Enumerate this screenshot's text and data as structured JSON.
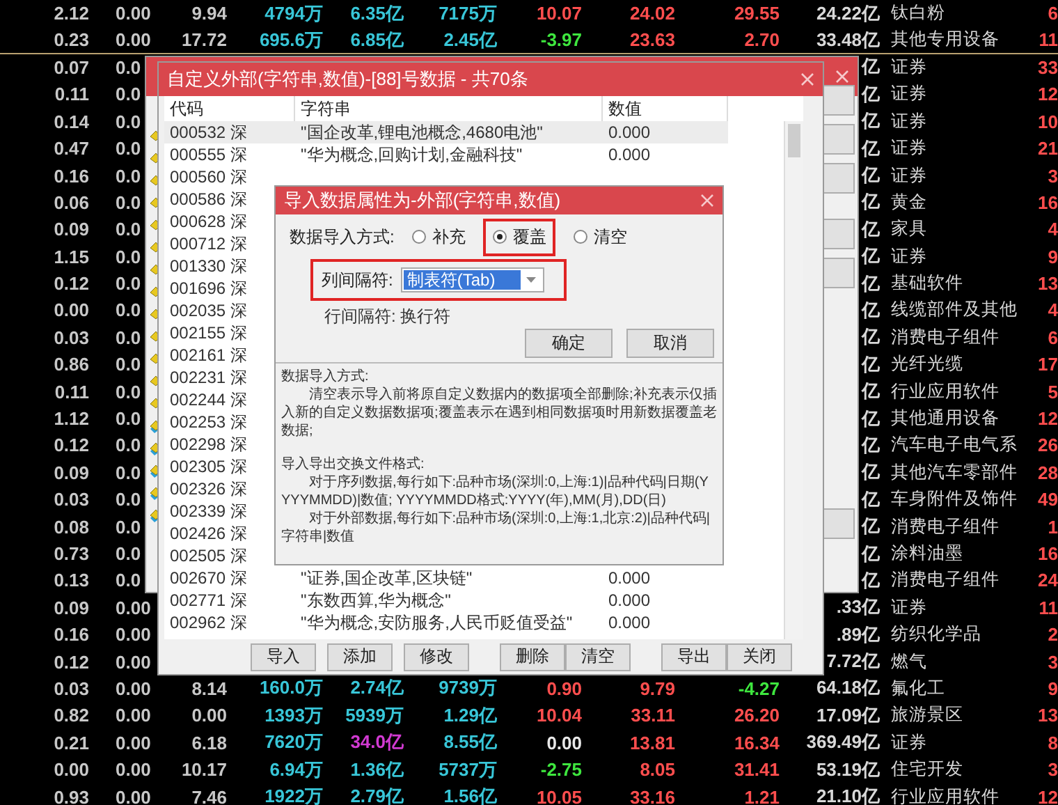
{
  "quote_table": {
    "rows": [
      {
        "cells": {
          "c1": "2.12",
          "c2": "0.00",
          "c3": "9.94",
          "c4": "4794万",
          "c5": "6.35亿",
          "c6": "7175万",
          "c7": "10.07",
          "c8": "24.02",
          "c9": "29.55",
          "c10": "24.22亿",
          "c11": "钛白粉",
          "c12": "6"
        }
      },
      {
        "cells": {
          "c1": "0.23",
          "c2": "0.00",
          "c3": "17.72",
          "c4": "695.6万",
          "c5": "6.85亿",
          "c6": "2.45亿",
          "c7": {
            "text": "-3.97",
            "color": "#3ee63e"
          },
          "c8": "23.63",
          "c9": "2.70",
          "c10": "33.48亿",
          "c11": "其他专用设备",
          "c12": "11"
        },
        "group_break": true
      },
      {
        "cells": {
          "c1": "0.07",
          "c2": "0.0",
          "c10": "亿",
          "c11": "证券",
          "c12": "33"
        }
      },
      {
        "cells": {
          "c1": "0.11",
          "c2": "0.0",
          "c10": "亿",
          "c11": "证券",
          "c12": "12"
        }
      },
      {
        "cells": {
          "c1": "0.14",
          "c2": "0.0",
          "c10": "亿",
          "c11": "证券",
          "c12": "10"
        }
      },
      {
        "cells": {
          "c1": "0.47",
          "c2": "0.0",
          "c10": "亿",
          "c11": "证券",
          "c12": "21"
        }
      },
      {
        "cells": {
          "c1": "0.16",
          "c2": "0.0",
          "c10": "亿",
          "c11": "证券",
          "c12": "3"
        }
      },
      {
        "cells": {
          "c1": "0.06",
          "c2": "0.0",
          "c10": "亿",
          "c11": "黄金",
          "c12": "16"
        }
      },
      {
        "cells": {
          "c1": "0.09",
          "c2": "0.0",
          "c10": "亿",
          "c11": "家具",
          "c12": "4"
        }
      },
      {
        "cells": {
          "c1": "1.15",
          "c2": "0.0",
          "c10": "亿",
          "c11": "证券",
          "c12": "9"
        }
      },
      {
        "cells": {
          "c1": "0.12",
          "c2": "0.0",
          "c10": "亿",
          "c11": "基础软件",
          "c12": "13"
        }
      },
      {
        "cells": {
          "c1": "0.00",
          "c2": "0.0",
          "c10": "亿",
          "c11": "线缆部件及其他",
          "c12": "4"
        }
      },
      {
        "cells": {
          "c1": "0.03",
          "c2": "0.0",
          "c10": "亿",
          "c11": "消费电子组件",
          "c12": "6"
        }
      },
      {
        "cells": {
          "c1": "0.86",
          "c2": "0.0",
          "c10": "亿",
          "c11": "光纤光缆",
          "c12": "17"
        }
      },
      {
        "cells": {
          "c1": "0.11",
          "c2": "0.0",
          "c10": "亿",
          "c11": "行业应用软件",
          "c12": "5"
        }
      },
      {
        "cells": {
          "c1": "1.12",
          "c2": "0.0",
          "c10": "亿",
          "c11": "其他通用设备",
          "c12": "12"
        }
      },
      {
        "cells": {
          "c1": "0.12",
          "c2": "0.0",
          "c10": "亿",
          "c11": "汽车电子电气系",
          "c12": "26"
        }
      },
      {
        "cells": {
          "c1": "0.09",
          "c2": "0.0",
          "c10": "亿",
          "c11": "其他汽车零部件",
          "c12": "28"
        }
      },
      {
        "cells": {
          "c1": "0.03",
          "c2": "0.0",
          "c10": "亿",
          "c11": "车身附件及饰件",
          "c12": "49"
        }
      },
      {
        "cells": {
          "c1": "0.08",
          "c2": "0.0",
          "c10": "亿",
          "c11": "消费电子组件",
          "c12": "1"
        }
      },
      {
        "cells": {
          "c1": "0.73",
          "c2": "0.0",
          "c10": "亿",
          "c11": "涂料油墨",
          "c12": "16"
        }
      },
      {
        "cells": {
          "c1": "0.13",
          "c2": "0.0",
          "c10": "亿",
          "c11": "消费电子组件",
          "c12": "24"
        }
      },
      {
        "cells": {
          "c1": "0.09",
          "c2": "0.00",
          "c10": ".33亿",
          "c11": "证券",
          "c12": "11"
        }
      },
      {
        "cells": {
          "c1": "0.16",
          "c2": "0.00",
          "c10": ".89亿",
          "c11": "纺织化学品",
          "c12": "2"
        }
      },
      {
        "cells": {
          "c1": "0.12",
          "c2": "0.00",
          "c10": "7.72亿",
          "c11": "燃气",
          "c12": "3"
        }
      },
      {
        "cells": {
          "c1": "0.03",
          "c2": "0.00",
          "c3": "8.14",
          "c4": "160.0万",
          "c5": "2.74亿",
          "c6": "9739万",
          "c7": "0.90",
          "c8": "9.79",
          "c9": {
            "text": "-4.27",
            "color": "#3ee63e"
          },
          "c10": "64.18亿",
          "c11": "氟化工",
          "c12": "9"
        }
      },
      {
        "cells": {
          "c1": "0.82",
          "c2": "0.00",
          "c3": "0.00",
          "c4": "1393万",
          "c5": "5939万",
          "c6": "1.29亿",
          "c7": "10.04",
          "c8": "33.11",
          "c9": "26.20",
          "c10": "17.09亿",
          "c11": "旅游景区",
          "c12": "13"
        }
      },
      {
        "cells": {
          "c1": "0.21",
          "c2": "0.00",
          "c3": "6.18",
          "c4": "7620万",
          "c5": {
            "text": "34.0亿",
            "color": "#d23ad2"
          },
          "c6": "8.55亿",
          "c7": {
            "text": "0.00",
            "color": "#e8e8e8"
          },
          "c8": "13.81",
          "c9": "16.34",
          "c10": "369.49亿",
          "c11": "证券",
          "c12": "8"
        }
      },
      {
        "cells": {
          "c1": "0.00",
          "c2": "0.00",
          "c3": "10.17",
          "c4": "6.94万",
          "c5": "1.36亿",
          "c6": "5737万",
          "c7": {
            "text": "-2.75",
            "color": "#3ee63e"
          },
          "c8": "8.05",
          "c9": "31.41",
          "c10": "53.19亿",
          "c11": "住宅开发",
          "c12": "3"
        }
      },
      {
        "cells": {
          "c1": "0.93",
          "c2": "0.00",
          "c3": "7.46",
          "c4": "1922万",
          "c5": "2.79亿",
          "c6": "1.56亿",
          "c7": "10.05",
          "c8": "33.16",
          "c9": "1.21",
          "c10": "21.10亿",
          "c11": "行业应用软件",
          "c12": "12"
        }
      }
    ]
  },
  "back_window": {
    "item_icons": [
      {
        "kind": "plain"
      },
      {
        "kind": "plain"
      },
      {
        "kind": "plain"
      },
      {
        "kind": "plain"
      },
      {
        "kind": "plain"
      },
      {
        "kind": "plain"
      },
      {
        "kind": "plain"
      },
      {
        "kind": "plain"
      },
      {
        "kind": "plain"
      },
      {
        "kind": "plain"
      },
      {
        "kind": "plain"
      },
      {
        "kind": "plain"
      },
      {
        "kind": "plain"
      },
      {
        "kind": "linked"
      },
      {
        "kind": "linked"
      },
      {
        "kind": "linked"
      },
      {
        "kind": "linked"
      },
      {
        "kind": "linked"
      }
    ]
  },
  "list_window": {
    "title": "自定义外部(字符串,数值)-[88]号数据 - 共70条",
    "columns": [
      "代码",
      "字符串",
      "数值"
    ],
    "rows": [
      {
        "code": "000532 深",
        "text": "\"国企改革,锂电池概念,4680电池\"",
        "value": "0.000",
        "selected": true
      },
      {
        "code": "000555 深",
        "text": "\"华为概念,回购计划,金融科技\"",
        "value": "0.000",
        "selected": false
      },
      {
        "code": "000560 深",
        "selected": false
      },
      {
        "code": "000586 深",
        "selected": false
      },
      {
        "code": "000628 深",
        "selected": false
      },
      {
        "code": "000712 深",
        "selected": false
      },
      {
        "code": "001330 深",
        "selected": false
      },
      {
        "code": "001696 深",
        "selected": false
      },
      {
        "code": "002035 深",
        "selected": false
      },
      {
        "code": "002155 深",
        "selected": false
      },
      {
        "code": "002161 深",
        "selected": false
      },
      {
        "code": "002231 深",
        "selected": false
      },
      {
        "code": "002244 深",
        "selected": false
      },
      {
        "code": "002253 深",
        "selected": false
      },
      {
        "code": "002298 深",
        "selected": false
      },
      {
        "code": "002305 深",
        "selected": false
      },
      {
        "code": "002326 深",
        "selected": false
      },
      {
        "code": "002339 深",
        "selected": false
      },
      {
        "code": "002426 深",
        "selected": false
      },
      {
        "code": "002505 深",
        "selected": false
      },
      {
        "code": "002670 深",
        "text": "\"证券,国企改革,区块链\"",
        "value": "0.000",
        "selected": false
      },
      {
        "code": "002771 深",
        "text": "\"东数西算,华为概念\"",
        "value": "0.000",
        "selected": false
      },
      {
        "code": "002962 深",
        "text": "\"华为概念,安防服务,人民币贬值受益\"",
        "value": "0.000",
        "selected": false
      }
    ],
    "buttons": [
      {
        "label": "导入",
        "kind": "left"
      },
      {
        "label": "添加",
        "kind": "left"
      },
      {
        "label": "修改",
        "kind": "left"
      },
      {
        "label": "删除",
        "kind": "mid"
      },
      {
        "label": "清空",
        "kind": "mid"
      },
      {
        "label": "导出",
        "kind": "right"
      },
      {
        "label": "关闭",
        "kind": "right"
      }
    ]
  },
  "import_dialog": {
    "title": "导入数据属性为-外部(字符串,数值)",
    "import_mode": {
      "label": "数据导入方式:",
      "options": [
        {
          "label": "补充",
          "selected": false,
          "highlighted": false
        },
        {
          "label": "覆盖",
          "selected": true,
          "highlighted": true
        },
        {
          "label": "清空",
          "selected": false,
          "highlighted": false
        }
      ]
    },
    "column_separator": {
      "label": "列间隔符:",
      "value": "制表符(Tab)",
      "highlighted": true
    },
    "row_separator": "行间隔符: 换行符",
    "buttons": [
      "确定",
      "取消"
    ],
    "help": [
      {
        "kind": "heading",
        "text": "数据导入方式:"
      },
      {
        "kind": "indent",
        "text": "清空表示导入前将原自定义数据内的数据项全部删除;补充表示仅插入新的自定义数据数据项;覆盖表示在遇到相同数据项时用新数据覆盖老数据;"
      },
      {
        "kind": "section",
        "text": "导入导出交换文件格式:"
      },
      {
        "kind": "indent",
        "text": "对于序列数据,每行如下:品种市场(深圳:0,上海:1)|品种代码|日期(YYYYMMDD)|数值;  YYYYMMDD格式:YYYY(年),MM(月),DD(日)"
      },
      {
        "kind": "indent",
        "text": "对于外部数据,每行如下:品种市场(深圳:0,上海:1,北京:2)|品种代码|字符串|数值"
      }
    ]
  }
}
